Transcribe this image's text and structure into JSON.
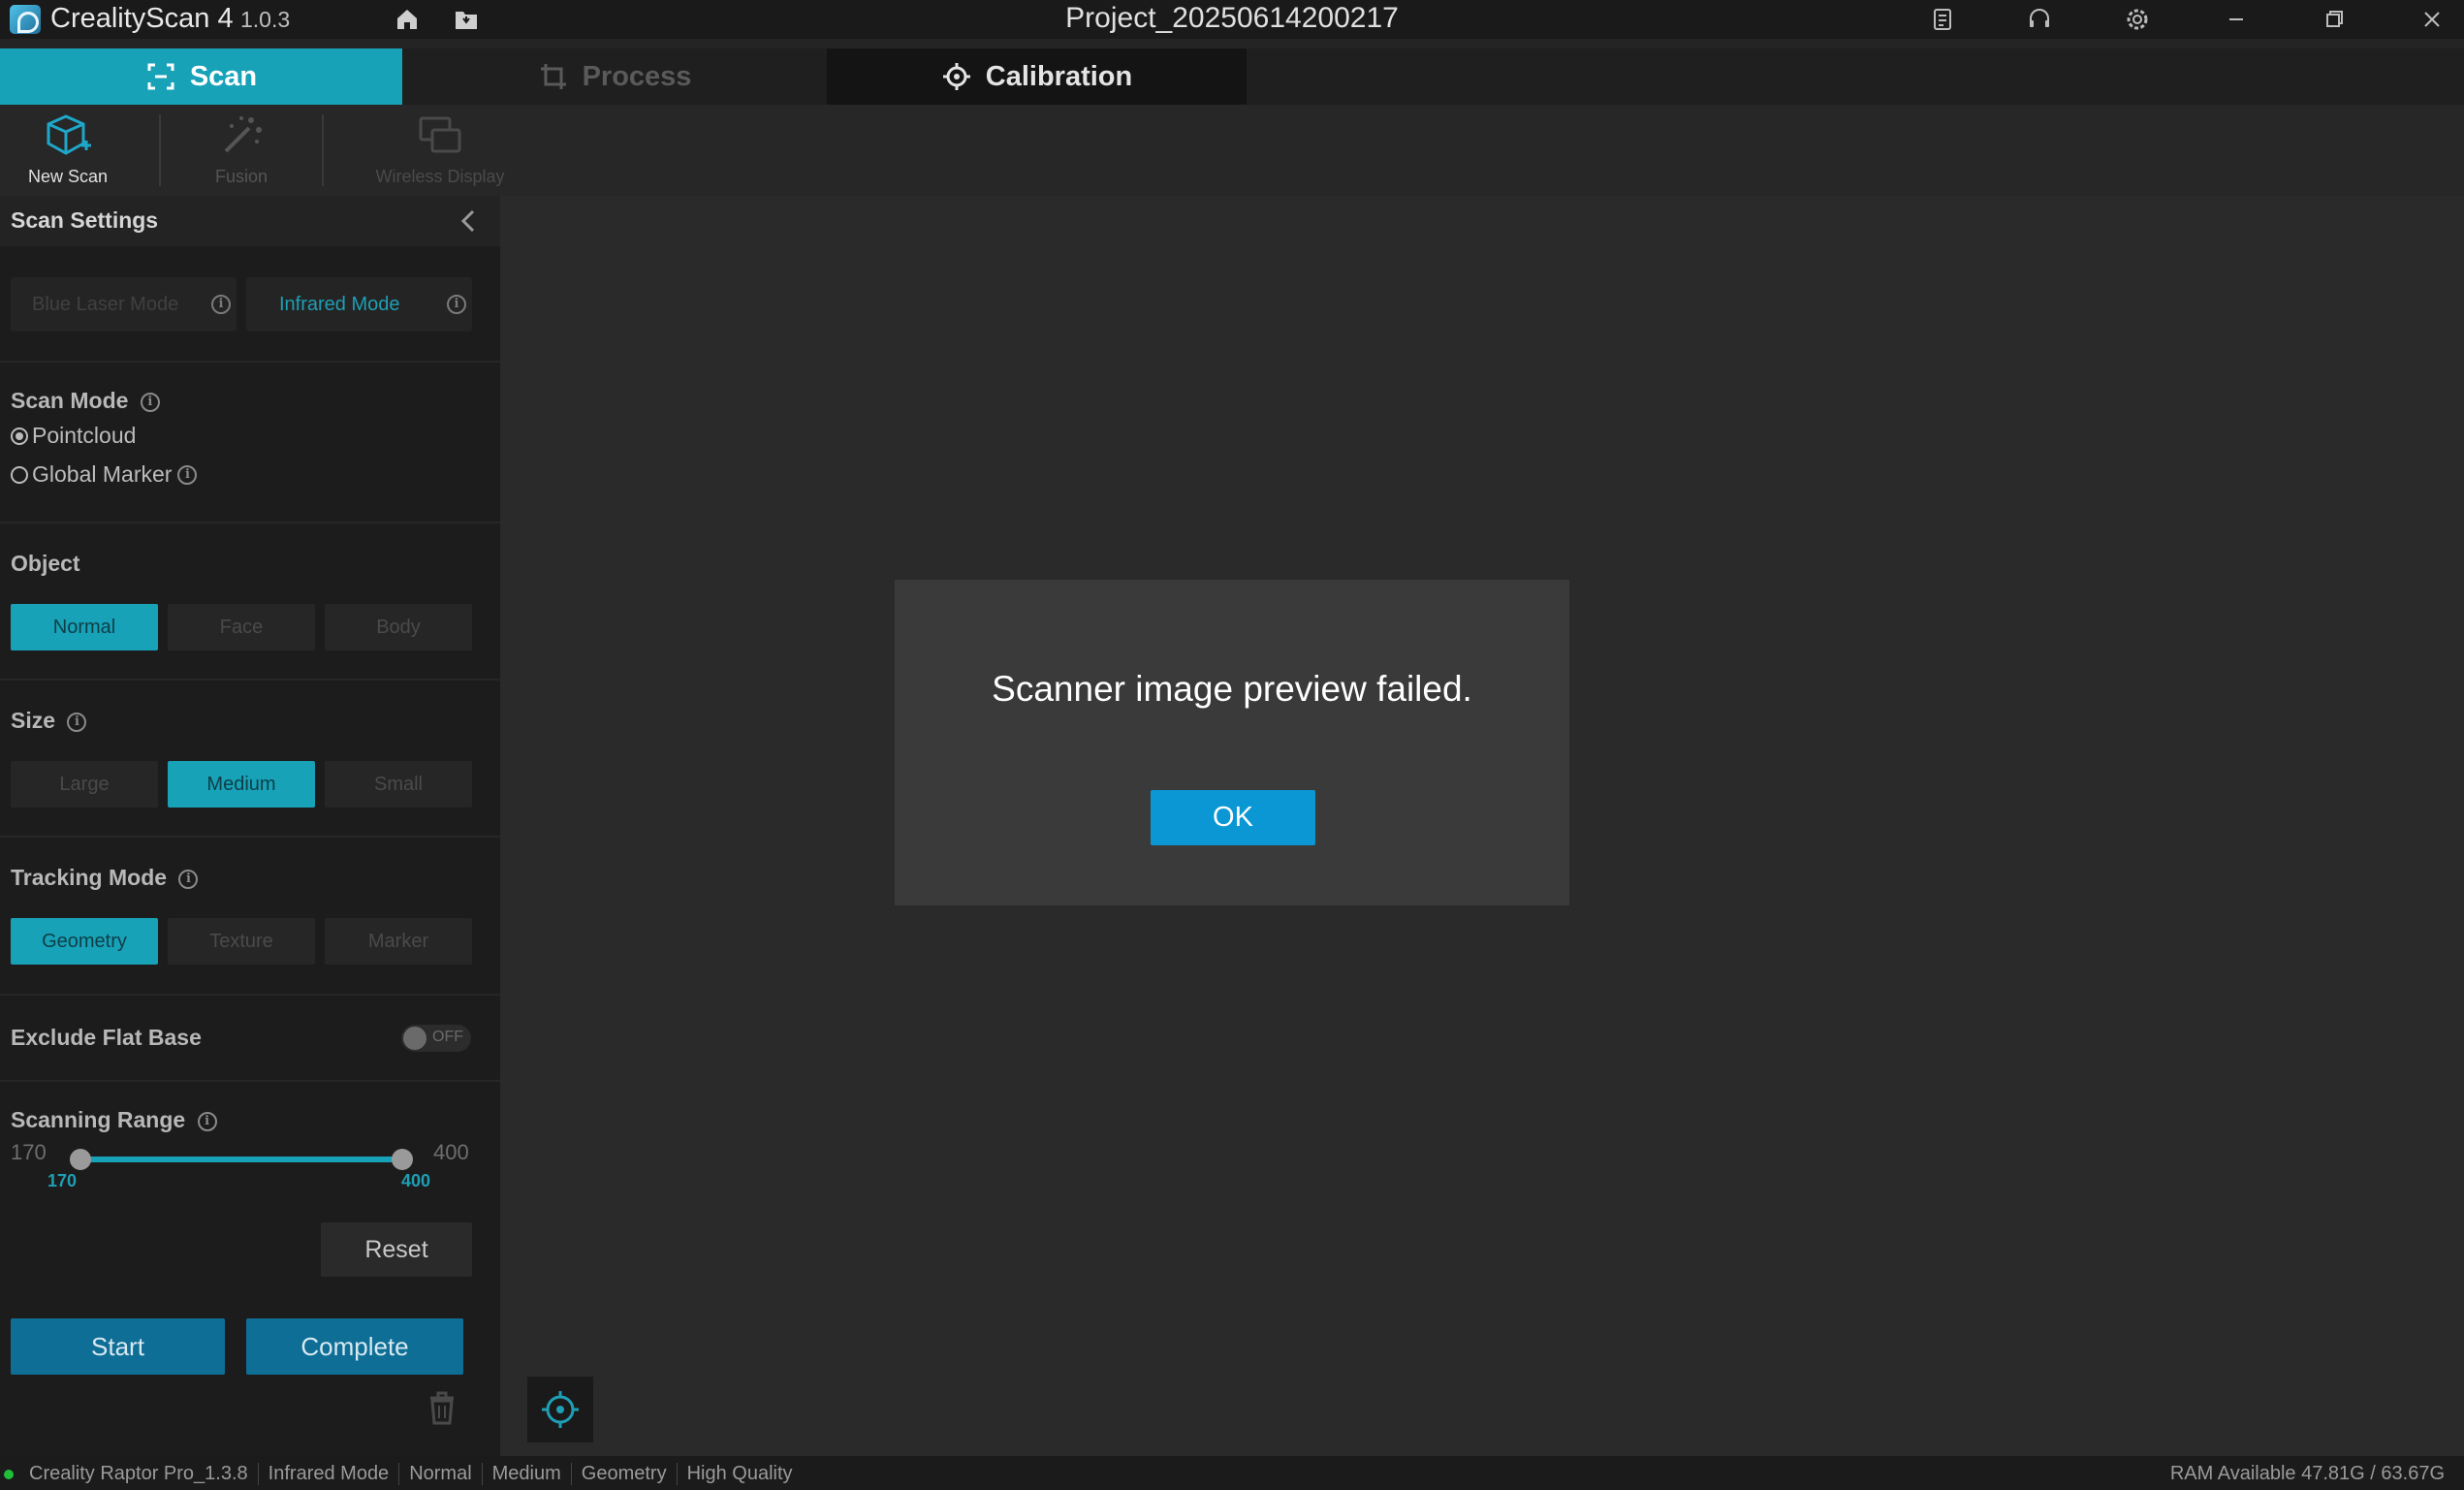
{
  "app": {
    "name": "CrealityScan 4",
    "version": "1.0.3",
    "project_title": "Project_20250614200217"
  },
  "tabs": [
    {
      "label": "Scan",
      "icon": "scan-frame-icon",
      "state": "active"
    },
    {
      "label": "Process",
      "icon": "crop-icon",
      "state": "disabled"
    },
    {
      "label": "Calibration",
      "icon": "crosshair-icon",
      "state": "inactive"
    }
  ],
  "toolbar": {
    "new_scan": "New Scan",
    "fusion": "Fusion",
    "wireless_display": "Wireless Display"
  },
  "sidebar": {
    "title": "Scan Settings",
    "light_modes": {
      "blue_laser": "Blue Laser Mode",
      "infrared": "Infrared Mode",
      "selected": "Infrared Mode"
    },
    "scan_mode": {
      "label": "Scan Mode",
      "options": [
        "Pointcloud",
        "Global Marker"
      ],
      "selected": "Pointcloud"
    },
    "object": {
      "label": "Object",
      "options": [
        "Normal",
        "Face",
        "Body"
      ],
      "selected": "Normal"
    },
    "size": {
      "label": "Size",
      "options": [
        "Large",
        "Medium",
        "Small"
      ],
      "selected": "Medium"
    },
    "tracking_mode": {
      "label": "Tracking Mode",
      "options": [
        "Geometry",
        "Texture",
        "Marker"
      ],
      "selected": "Geometry"
    },
    "exclude_flat_base": {
      "label": "Exclude Flat Base",
      "state": "OFF"
    },
    "scanning_range": {
      "label": "Scanning Range",
      "min": "170",
      "max": "400",
      "low_value": "170",
      "high_value": "400"
    },
    "reset_label": "Reset",
    "start_label": "Start",
    "complete_label": "Complete"
  },
  "dialog": {
    "message": "Scanner image preview failed.",
    "ok_label": "OK"
  },
  "statusbar": {
    "device": "Creality Raptor Pro_1.3.8",
    "items": [
      "Infrared Mode",
      "Normal",
      "Medium",
      "Geometry",
      "High Quality"
    ],
    "ram": "RAM Available 47.81G / 63.67G"
  },
  "colors": {
    "accent": "#17a2b8",
    "primary_button": "#0e6e96",
    "dialog_ok": "#0a97d4",
    "status_connected": "#1fbf3a"
  }
}
